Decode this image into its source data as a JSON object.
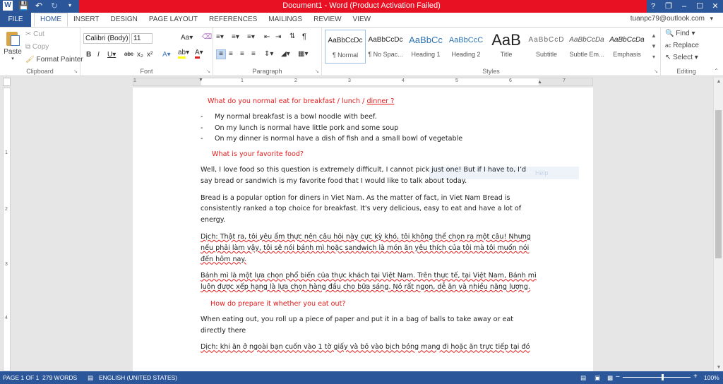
{
  "title_bar": {
    "title": "Document1 - Word (Product Activation Failed)",
    "controls": [
      "?",
      "❐",
      "–",
      "☐",
      "✕"
    ]
  },
  "account": {
    "email": "tuanpc79@outlook.com"
  },
  "tabs": {
    "file": "FILE",
    "items": [
      "HOME",
      "INSERT",
      "DESIGN",
      "PAGE LAYOUT",
      "REFERENCES",
      "MAILINGS",
      "REVIEW",
      "VIEW"
    ]
  },
  "ribbon": {
    "clipboard": {
      "label": "Clipboard",
      "paste": "Paste",
      "cut": "Cut",
      "copy": "Copy",
      "format_painter": "Format Painter"
    },
    "font": {
      "label": "Font",
      "font_name": "Calibri (Body)",
      "font_size": "11"
    },
    "paragraph": {
      "label": "Paragraph"
    },
    "styles": {
      "label": "Styles",
      "items": [
        {
          "sample": "AaBbCcDc",
          "name": "¶ Normal"
        },
        {
          "sample": "AaBbCcDc",
          "name": "¶ No Spac..."
        },
        {
          "sample": "AaBbCc",
          "name": "Heading 1"
        },
        {
          "sample": "AaBbCcC",
          "name": "Heading 2"
        },
        {
          "sample": "AaB",
          "name": "Title"
        },
        {
          "sample": "AaBbCcD",
          "name": "Subtitle"
        },
        {
          "sample": "AaBbCcDa",
          "name": "Subtle Em..."
        },
        {
          "sample": "AaBbCcDa",
          "name": "Emphasis"
        }
      ]
    },
    "editing": {
      "label": "Editing",
      "find": "Find",
      "replace": "Replace",
      "select": "Select"
    }
  },
  "ruler": {
    "h_numbers": [
      "1",
      "1",
      "2",
      "3",
      "4",
      "5",
      "6",
      "7"
    ],
    "v_numbers": [
      "1",
      "2",
      "3",
      "4"
    ]
  },
  "document": {
    "q1_text": "What do you normal eat for breakfast / lunch / ",
    "q1_link": "dinner ?",
    "bullets": [
      "My normal breakfast is a bowl noodle with beef.",
      "On my lunch is normal have little pork and some soup",
      "On my dinner is normal have a dish of fish and a small bowl of vegetable"
    ],
    "q2": "What is your favorite food?",
    "p1": "Well, I love food so this question is extremely difficult, I cannot pick just one! But if I have to, I’d say bread or sandwich is my favorite food that I would like to talk about today.",
    "p2": "Bread is a popular option for diners in Viet Nam. As the matter of fact, in Viet Nam Bread is consistently ranked a top choice for breakfast. It's very delicious, easy to eat and have a lot of energy.",
    "p3": "Dịch: Thật ra, tôi yêu ẩm thực nên câu hỏi này cực kỳ khó, tôi không thể chọn ra một câu! Nhưng nếu phải làm vậy, tôi sẽ nói bánh mì hoặc sandwich là món ăn yêu thích của tôi mà tôi muốn nói đến hôm nay.",
    "p4": "Bánh mì là một lựa chọn phổ biến của thực khách tại Việt Nam. Trên thực tế, tại Việt Nam, Bánh mì luôn được xếp hạng là lựa chọn hàng đầu cho bữa sáng. Nó rất ngon, dễ ăn và nhiều năng lượng.",
    "q3": "How do prepare it whether you eat out?",
    "p5": "When eating out, you roll up a piece of paper and put it in a bag of balls to take away or eat directly there",
    "p6": "Dịch: khi ăn ở ngoài bạn cuốn vào 1 tờ giấy và bỏ vào bịch bóng mang đi hoặc ăn trực tiếp tại đó",
    "ghost_text": "Help"
  },
  "status_bar": {
    "page": "PAGE 1 OF 1",
    "words": "279 WORDS",
    "language": "ENGLISH (UNITED STATES)",
    "zoom_percent": "100%",
    "zoom_minus": "–",
    "zoom_plus": "+"
  },
  "colors": {
    "word_blue": "#2b579a",
    "alert_red": "#e81123",
    "heading_red": "#e51a1a"
  }
}
